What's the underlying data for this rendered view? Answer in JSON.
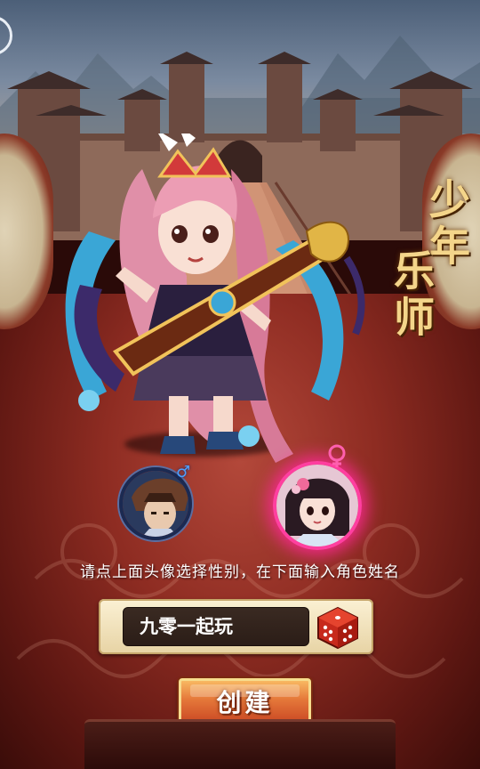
{
  "title": {
    "line1": "少年",
    "line2": "乐师"
  },
  "instruction": "请点上面头像选择性别，在下面输入角色姓名",
  "name_field": {
    "value": "九零一起玩"
  },
  "create_button": {
    "label": "创建"
  },
  "gender": {
    "male_symbol": "♂",
    "selected": "female"
  },
  "colors": {
    "accent_female": "#ff3fa0",
    "accent_male": "#4da0ff",
    "button": "#e5783a",
    "title_gold": "#f4d58a"
  },
  "icons": [
    "dice-icon",
    "male-symbol-icon",
    "female-avatar",
    "male-avatar"
  ]
}
